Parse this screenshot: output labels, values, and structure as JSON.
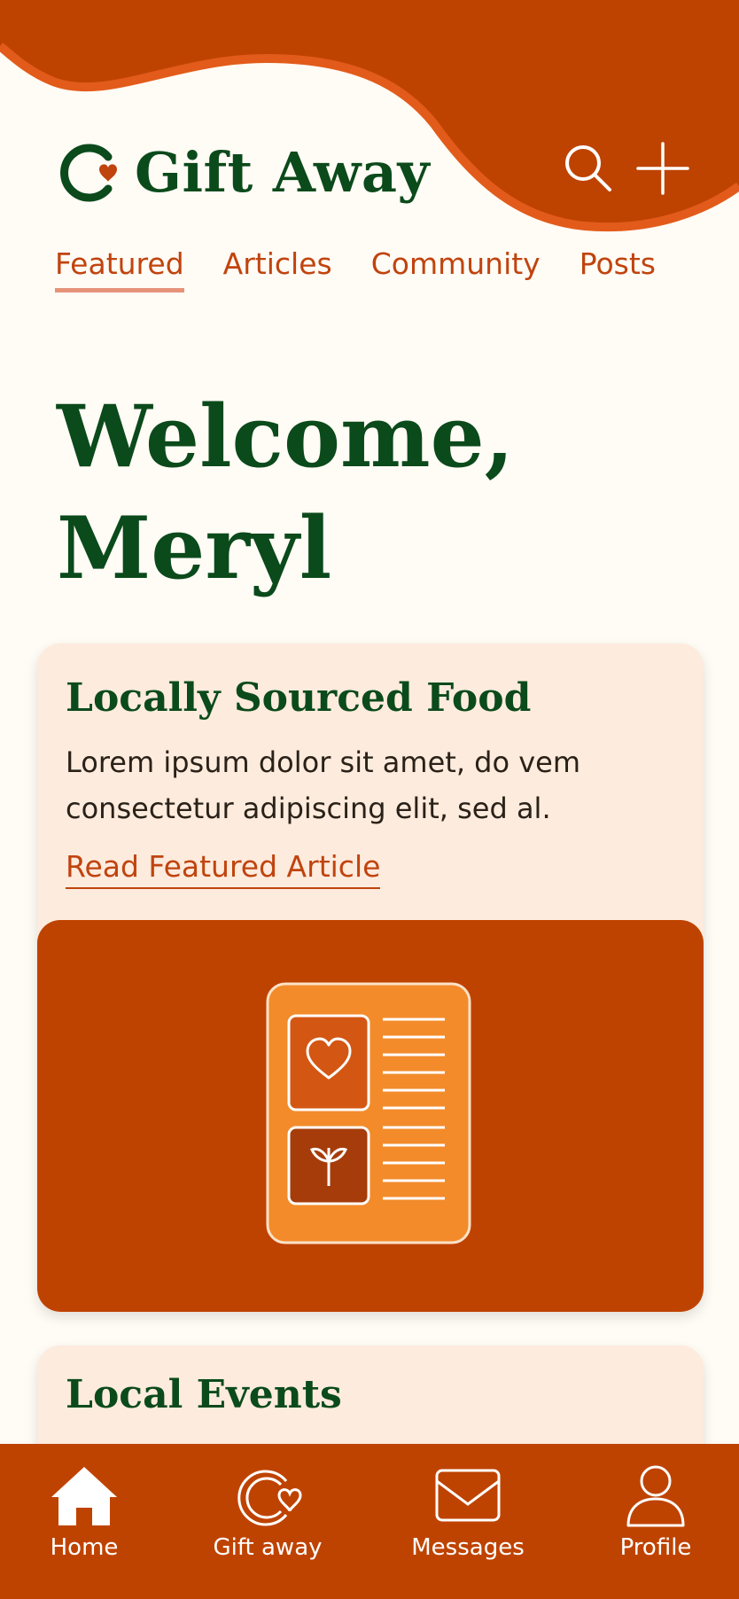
{
  "app": {
    "title": "Gift Away"
  },
  "colors": {
    "brand": "#BF4300",
    "accent_green": "#0B4A1B",
    "background": "#FFFBF5",
    "card": "#FDEBDD",
    "illustration_orange": "#F38B2B"
  },
  "header": {
    "search_icon": "search-icon",
    "add_icon": "plus-icon"
  },
  "tabs": [
    {
      "label": "Featured",
      "active": true
    },
    {
      "label": "Articles",
      "active": false
    },
    {
      "label": "Community",
      "active": false
    },
    {
      "label": "Posts",
      "active": false
    }
  ],
  "welcome": {
    "line1": "Welcome,",
    "line2": "Meryl"
  },
  "featured_card": {
    "title": "Locally Sourced Food",
    "body": "Lorem ipsum dolor sit amet, do vem consectetur adipiscing elit, sed al.",
    "link": "Read Featured Article",
    "illustration": "article-illustration-icon"
  },
  "events_card": {
    "title": "Local Events"
  },
  "bottom_nav": [
    {
      "label": "Home",
      "icon": "home-icon"
    },
    {
      "label": "Gift away",
      "icon": "gift-away-icon"
    },
    {
      "label": "Messages",
      "icon": "envelope-icon"
    },
    {
      "label": "Profile",
      "icon": "person-icon"
    }
  ]
}
